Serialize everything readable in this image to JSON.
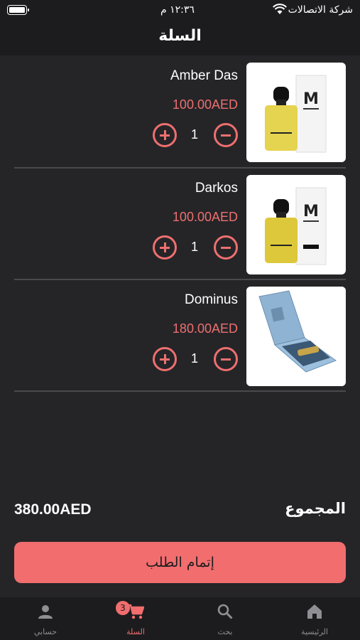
{
  "status_bar": {
    "time": "١٢:٣٦ م",
    "carrier": "شركة الاتصالات"
  },
  "header": {
    "title": "السلة"
  },
  "cart": {
    "items": [
      {
        "name": "Amber Das",
        "price": "100.00AED",
        "quantity": "1"
      },
      {
        "name": "Darkos",
        "price": "100.00AED",
        "quantity": "1"
      },
      {
        "name": "Dominus",
        "price": "180.00AED",
        "quantity": "1"
      }
    ]
  },
  "summary": {
    "total_label": "المجموع",
    "total_value": "380.00AED"
  },
  "checkout": {
    "label": "إتمام الطلب"
  },
  "bottom_nav": {
    "account": "حسابي",
    "cart": "السلة",
    "cart_badge": "3",
    "search": "بحث",
    "home": "الرئيسية"
  },
  "colors": {
    "accent": "#f16d6e",
    "background": "#252528",
    "bar": "#1c1c1e"
  }
}
